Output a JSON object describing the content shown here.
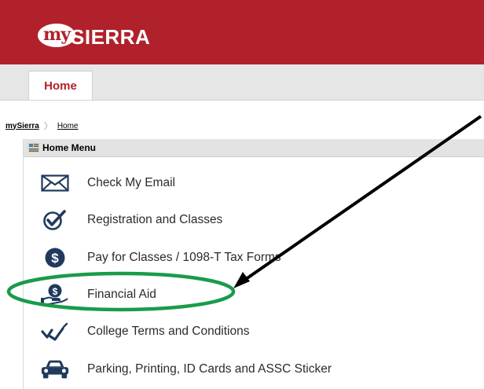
{
  "header": {
    "logo_my": "my",
    "logo_sierra": "SIERRA",
    "color": "#b1212b"
  },
  "tabs": [
    {
      "label": "Home",
      "active": true
    }
  ],
  "breadcrumb": {
    "root": "mySierra",
    "current": "Home"
  },
  "menu": {
    "title": "Home Menu",
    "items": [
      {
        "label": "Check My Email",
        "icon": "envelope-icon"
      },
      {
        "label": "Registration and Classes",
        "icon": "check-circle-icon"
      },
      {
        "label": "Pay for Classes / 1098-T Tax Forms",
        "icon": "dollar-circle-icon"
      },
      {
        "label": "Financial Aid",
        "icon": "hand-dollar-icon",
        "highlighted": true
      },
      {
        "label": "College Terms and Conditions",
        "icon": "signature-check-icon"
      },
      {
        "label": "Parking, Printing, ID Cards and ASSC Sticker",
        "icon": "car-icon"
      }
    ]
  },
  "annotation": {
    "ellipse_color": "#1a9b4b",
    "arrow_color": "#000000"
  }
}
